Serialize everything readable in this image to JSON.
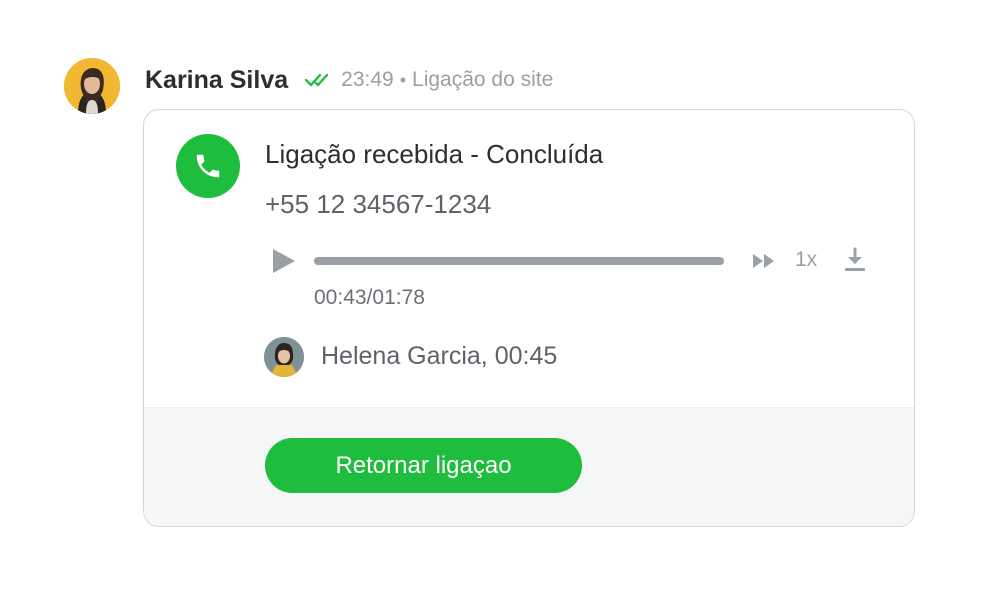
{
  "message": {
    "sender_name": "Karina Silva",
    "time": "23:49",
    "separator": "•",
    "channel": "Ligação do site",
    "read_status_icon": "double-check-icon",
    "status_color": "#1fbd3d"
  },
  "call_card": {
    "icon": "phone-icon",
    "title": "Ligação recebida - Concluída",
    "phone_number": "+55 12 34567-1234",
    "player": {
      "play_icon": "play-icon",
      "progress_fraction": 1.0,
      "fast_forward_icon": "fast-forward-icon",
      "speed_label": "1x",
      "download_icon": "download-icon",
      "time_readout": "00:43/01:78"
    },
    "agent": {
      "avatar_icon": "avatar",
      "label": "Helena Garcia, 00:45"
    },
    "return_button_label": "Retornar ligaçao"
  },
  "colors": {
    "accent_green": "#1fbd3d",
    "muted_text": "#9aa0a6",
    "card_border": "#d6d9dc",
    "footer_bg": "#f4f6f7"
  }
}
